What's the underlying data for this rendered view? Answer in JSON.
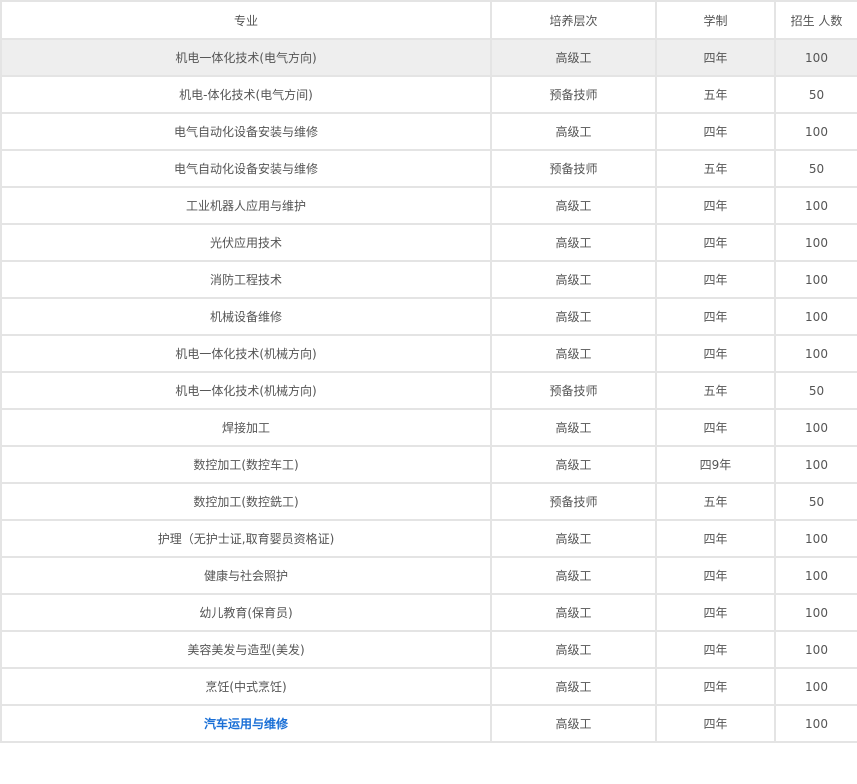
{
  "table": {
    "headers": {
      "major": "专业",
      "level": "培养层次",
      "years": "学制",
      "count": "招生 人数"
    },
    "rows": [
      {
        "major": "机电一体化技术(电气方向)",
        "level": "高级工",
        "years": "四年",
        "count": "100"
      },
      {
        "major": "机电-体化技术(电气方间)",
        "level": "预备技师",
        "years": "五年",
        "count": "50"
      },
      {
        "major": "电气自动化设备安装与维修",
        "level": "高级工",
        "years": "四年",
        "count": "100"
      },
      {
        "major": "电气自动化设备安装与维修",
        "level": "预备技师",
        "years": "五年",
        "count": "50"
      },
      {
        "major": "工业机器人应用与维护",
        "level": "高级工",
        "years": "四年",
        "count": "100"
      },
      {
        "major": "光伏应用技术",
        "level": "高级工",
        "years": "四年",
        "count": "100"
      },
      {
        "major": "消防工程技术",
        "level": "高级工",
        "years": "四年",
        "count": "100"
      },
      {
        "major": "机械设备维修",
        "level": "高级工",
        "years": "四年",
        "count": "100"
      },
      {
        "major": "机电一体化技术(机械方向)",
        "level": "高级工",
        "years": "四年",
        "count": "100"
      },
      {
        "major": "机电一体化技术(机械方向)",
        "level": "预备技师",
        "years": "五年",
        "count": "50"
      },
      {
        "major": "焊接加工",
        "level": "高级工",
        "years": "四年",
        "count": "100"
      },
      {
        "major": "数控加工(数控车工)",
        "level": "高级工",
        "years": "四9年",
        "count": "100"
      },
      {
        "major": "数控加工(数控銑工)",
        "level": "预备技师",
        "years": "五年",
        "count": "50"
      },
      {
        "major": "护理（无护士证,取育婴员资格证)",
        "level": "高级工",
        "years": "四年",
        "count": "100"
      },
      {
        "major": "健康与社会照护",
        "level": "高级工",
        "years": "四年",
        "count": "100"
      },
      {
        "major": "幼儿教育(保育员)",
        "level": "高级工",
        "years": "四年",
        "count": "100"
      },
      {
        "major": "美容美发与造型(美发)",
        "level": "高级工",
        "years": "四年",
        "count": "100"
      },
      {
        "major": "烹饪(中式烹饪)",
        "level": "高级工",
        "years": "四年",
        "count": "100"
      },
      {
        "major": "汽车运用与维修",
        "level": "高级工",
        "years": "四年",
        "count": "100"
      }
    ]
  },
  "colors": {
    "border": "#e4e4e4",
    "text": "#555555",
    "highlight_row": "#eeeeee",
    "link": "#1a6fd6"
  }
}
